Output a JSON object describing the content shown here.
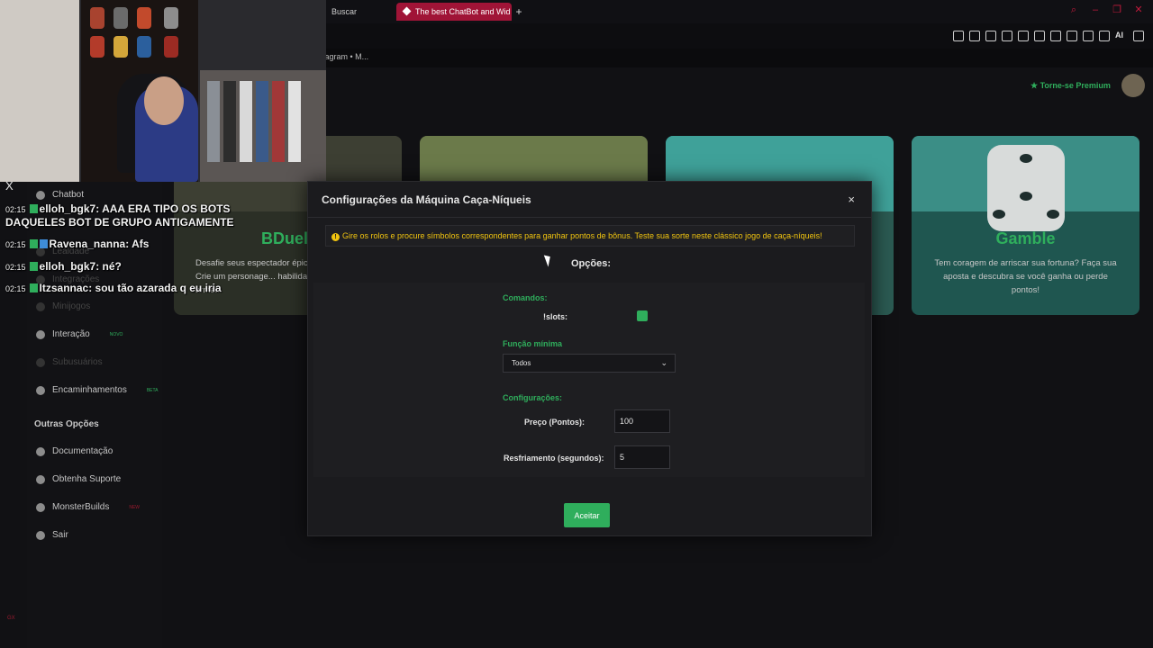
{
  "browser": {
    "tabs": [
      {
        "label": "Buscar"
      },
      {
        "label": "The best ChatBot and Wid",
        "active": true
      }
    ],
    "new_tab": "+",
    "bookmark": "tagram • M...",
    "toolbar_ai": "AI"
  },
  "app": {
    "premium_label": "Torne-se Premium",
    "cards": [
      {
        "title": "BDuel",
        "description": "Desafie seus espectador épicas! Crie um personage... habilidades, arma..."
      },
      {
        "title": "",
        "description": ""
      },
      {
        "title": "",
        "description": ""
      },
      {
        "title": "Gamble",
        "description": "Tem coragem de arriscar sua fortuna? Faça sua aposta e descubra se você ganha ou perde pontos!"
      }
    ],
    "sidebar": {
      "items": [
        {
          "label": "Chatbot",
          "icon": "robot-icon",
          "dim": false
        },
        {
          "label": "Lealdade",
          "icon": "star-icon",
          "dim": true
        },
        {
          "label": "Integrações",
          "icon": "plug-icon",
          "dim": true
        },
        {
          "label": "Minijogos",
          "icon": "gamepad-icon",
          "dim": true
        },
        {
          "label": "Interação",
          "icon": "music-icon",
          "dim": false,
          "badge": "NOVO"
        },
        {
          "label": "Subusuários",
          "icon": "users-icon",
          "dim": true
        },
        {
          "label": "Encaminhamentos",
          "icon": "group-icon",
          "dim": false,
          "badge": "BETA"
        }
      ],
      "other_heading": "Outras Opções",
      "other_items": [
        {
          "label": "Documentação",
          "icon": "document-icon"
        },
        {
          "label": "Obtenha Suporte",
          "icon": "support-icon"
        },
        {
          "label": "MonsterBuilds",
          "icon": "monitor-icon",
          "badge": "NEW"
        },
        {
          "label": "Sair",
          "icon": "logout-icon"
        }
      ]
    }
  },
  "overlay": {
    "close": "X",
    "chat": [
      {
        "time": "02:15",
        "user": "elloh_bgk7",
        "text": ": AAA ERA TIPO OS BOTS"
      },
      {
        "time": "",
        "user": "",
        "text": "DAQUELES BOT DE GRUPO ANTIGAMENTE"
      },
      {
        "time": "02:15",
        "user": "Ravena_nanna",
        "text": ": Afs"
      },
      {
        "time": "02:15",
        "user": "elloh_bgk7",
        "text": ": né?"
      },
      {
        "time": "02:15",
        "user": "Itzsannac",
        "text": ": sou tão azarada q eu iria"
      }
    ],
    "corner_tag": "GX"
  },
  "modal": {
    "title": "Configurações da Máquina Caça-Níqueis",
    "close": "×",
    "alert_icon": "!",
    "alert": "Gire os rolos e procure símbolos correspondentes para ganhar pontos de bônus. Teste sua sorte neste clássico jogo de caça-níqueis!",
    "options_title": "Opções:",
    "commands_label": "Comandos:",
    "command_name": "!slots:",
    "command_enabled": true,
    "min_role_label": "Função mínima",
    "min_role_value": "Todos",
    "settings_label": "Configurações:",
    "price_label": "Preço (Pontos):",
    "price_value": "100",
    "cooldown_label": "Resfriamento (segundos):",
    "cooldown_value": "5",
    "accept_label": "Aceitar"
  },
  "colors": {
    "accent_green": "#2fae5c",
    "alert_yellow": "#f1c40f",
    "tab_red": "#a01437"
  }
}
